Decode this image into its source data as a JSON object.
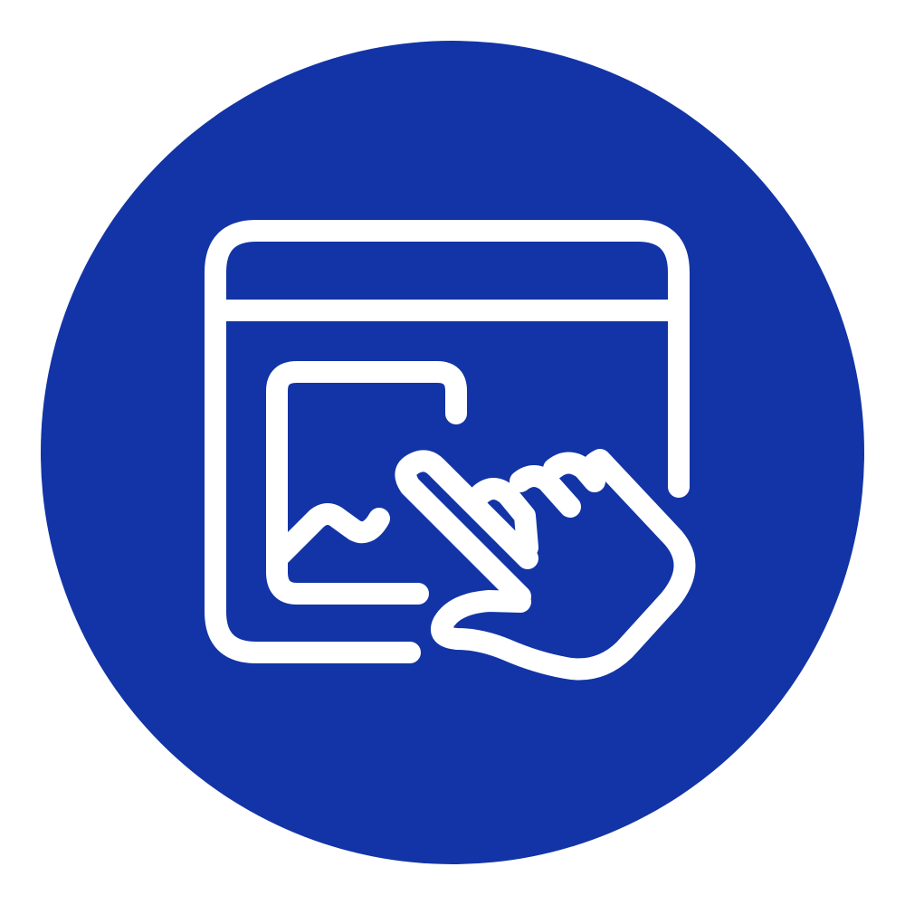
{
  "icon": {
    "name": "browser-image-tap-icon",
    "circle_color": "#1234A6",
    "stroke_color": "#FFFFFF",
    "background_color": "#FFFFFF"
  }
}
